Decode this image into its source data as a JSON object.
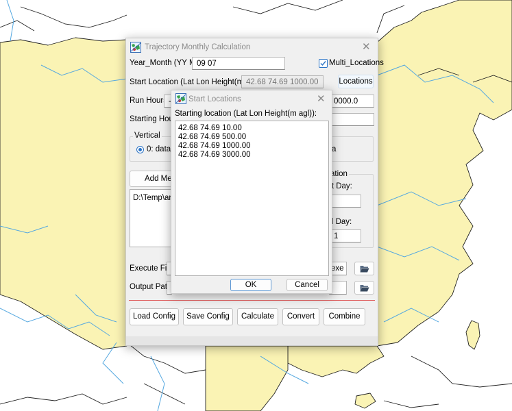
{
  "colors": {
    "land": "#faf3b4",
    "water_background": "#ffffff",
    "border_lines": "#222222",
    "rivers": "#55a8e0",
    "separator": "#e06060",
    "accent": "#2a73c5"
  },
  "main_window": {
    "title": "Trajectory Monthly Calculation",
    "year_month_label": "Year_Month (YY MM):",
    "year_month_value": "09 07",
    "multi_locations_label": "Multi_Locations",
    "multi_locations_checked": true,
    "start_location_label": "Start Location (Lat Lon Height(m agl)):",
    "start_location_value": "42.68 74.69 1000.00",
    "locations_button": "Locations",
    "run_hours_label": "Run Hours:",
    "run_hours_value": "-",
    "model_top_value_visible": "0000.0",
    "starting_hours_label": "Starting Hours",
    "vertical_group_label": "Vertical",
    "vertical_option_label": "0: data",
    "right_option_partial": "a",
    "add_meteo_button_partial": "Add Meteo",
    "meteo_file_partial": "D:\\Temp\\arl\\",
    "duration_group_partial": "ation",
    "start_day_partial": "rt Day:",
    "end_day_partial": "d Day:",
    "end_day_value_partial": "1",
    "execute_file_label": "Execute File:",
    "execute_file_value_partial": "exe",
    "output_path_label": "Output Path:",
    "buttons": {
      "load_config": "Load Config",
      "save_config": "Save Config",
      "calculate": "Calculate",
      "convert": "Convert",
      "combine": "Combine"
    }
  },
  "dialog": {
    "title": "Start Locations",
    "list_label": "Starting location (Lat Lon Height(m agl)):",
    "locations": [
      "42.68 74.69 10.00",
      "42.68 74.69 500.00",
      "42.68 74.69 1000.00",
      "42.68 74.69 3000.00"
    ],
    "ok_button": "OK",
    "cancel_button": "Cancel"
  },
  "icons": {
    "app": "application-globe-icon",
    "close": "close-icon",
    "folder": "folder-open-icon"
  }
}
